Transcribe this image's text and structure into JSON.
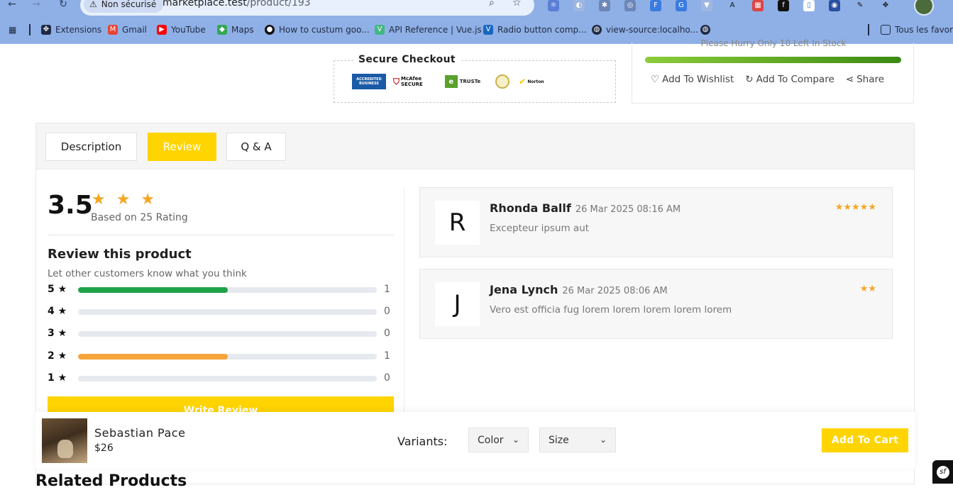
{
  "browser": {
    "not_secure": "Non sécurisé",
    "url_host": "marketplace.test",
    "url_path": "/product/193",
    "bookmarks": [
      {
        "label": "Extensions"
      },
      {
        "label": "Gmail"
      },
      {
        "label": "YouTube"
      },
      {
        "label": "Maps"
      },
      {
        "label": "How to custum goo..."
      },
      {
        "label": "API Reference | Vue.js"
      },
      {
        "label": "Radio button comp..."
      },
      {
        "label": "view-source:localho..."
      }
    ],
    "all_bookmarks": "Tous les favoris"
  },
  "checkout": {
    "title": "Secure Checkout",
    "badges": [
      "ACCREDITED BUSINESS",
      "McAfee SECURE",
      "TRUSTe",
      "",
      "Norton"
    ]
  },
  "stock": {
    "hurry_text": "Please Hurry Only 10 Left In Stock",
    "actions": {
      "wishlist": "Add To Wishlist",
      "compare": "Add To Compare",
      "share": "Share"
    }
  },
  "tabs": {
    "description": "Description",
    "review": "Review",
    "qa": "Q & A"
  },
  "summary": {
    "average": "3.5",
    "stars": "★ ★ ★",
    "based_on": "Based on 25 Rating",
    "title": "Review this product",
    "subtitle": "Let other customers know what you think",
    "write_label": "Write Review",
    "breakdown": [
      {
        "label": "5 ★",
        "count": "1",
        "fill_percent": 50,
        "color": "#1fa34a"
      },
      {
        "label": "4 ★",
        "count": "0",
        "fill_percent": 0,
        "color": "#1fa34a"
      },
      {
        "label": "3 ★",
        "count": "0",
        "fill_percent": 0,
        "color": "#1fa34a"
      },
      {
        "label": "2 ★",
        "count": "1",
        "fill_percent": 50,
        "color": "#f6a53a"
      },
      {
        "label": "1 ★",
        "count": "0",
        "fill_percent": 0,
        "color": "#1fa34a"
      }
    ]
  },
  "reviews": [
    {
      "initial": "R",
      "name": "Rhonda Ballf",
      "date": "26 Mar 2025 08:16 AM",
      "text": "Excepteur ipsum aut",
      "stars": "★★★★★"
    },
    {
      "initial": "J",
      "name": "Jena Lynch",
      "date": "26 Mar 2025 08:06 AM",
      "text": "Vero est officia fug lorem lorem lorem lorem lorem",
      "stars": "★★"
    }
  ],
  "sticky": {
    "name": "Sebastian Pace",
    "price": "$26",
    "variants_label": "Variants:",
    "color_select": "Color",
    "size_select": "Size",
    "cart_label": "Add To Cart"
  },
  "related_title": "Related Products",
  "colors": {
    "accent": "#ffd400",
    "star": "#f5a623"
  }
}
